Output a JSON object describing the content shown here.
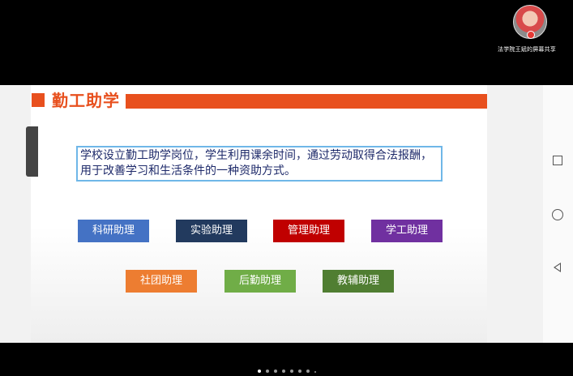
{
  "header": {
    "sharer_label": "法学院王斌的屏幕共享"
  },
  "slide": {
    "title": "勤工助学",
    "description": "学校设立勤工助学岗位，学生利用课余时间，通过劳动取得合法报酬，用于改善学习和生活条件的一种资助方式。",
    "buttons": [
      {
        "label": "科研助理",
        "color": "#4472c4"
      },
      {
        "label": "实验助理",
        "color": "#223a5e"
      },
      {
        "label": "管理助理",
        "color": "#c00000"
      },
      {
        "label": "学工助理",
        "color": "#7030a0"
      },
      {
        "label": "社团助理",
        "color": "#ed7d31"
      },
      {
        "label": "后勤助理",
        "color": "#70ad47"
      },
      {
        "label": "教辅助理",
        "color": "#507e32"
      }
    ],
    "accent_color": "#e8501e"
  },
  "nav": {
    "icons": [
      "square-icon",
      "circle-icon",
      "back-triangle-icon"
    ]
  },
  "pager": {
    "page_count": 8,
    "active_index": 0
  }
}
